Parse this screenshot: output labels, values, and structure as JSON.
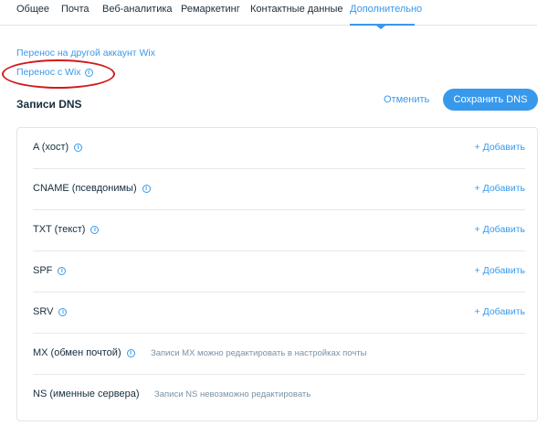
{
  "tabs": [
    {
      "label": "Общее"
    },
    {
      "label": "Почта"
    },
    {
      "label": "Веб-аналитика"
    },
    {
      "label": "Ремаркетинг"
    },
    {
      "label": "Контактные данные"
    },
    {
      "label": "Дополнительно",
      "active": true
    }
  ],
  "links": {
    "transfer_to_account": "Перенос на другой аккаунт Wix",
    "transfer_from_wix": "Перенос с Wix"
  },
  "dns": {
    "title": "Записи DNS",
    "cancel_label": "Отменить",
    "save_label": "Сохранить DNS",
    "add_label": "+ Добавить",
    "records": [
      {
        "label": "A (хост)"
      },
      {
        "label": "CNAME (псевдонимы)"
      },
      {
        "label": "TXT (текст)"
      },
      {
        "label": "SPF"
      },
      {
        "label": "SRV"
      },
      {
        "label": "MX (обмен почтой)",
        "note": "Записи MX можно редактировать в настройках почты"
      },
      {
        "label": "NS (именные сервера)",
        "note": "Записи NS невозможно редактировать"
      }
    ]
  },
  "colors": {
    "accent": "#3899ec",
    "annotation": "#d21a1a"
  },
  "icons": {
    "info": "info-icon"
  }
}
